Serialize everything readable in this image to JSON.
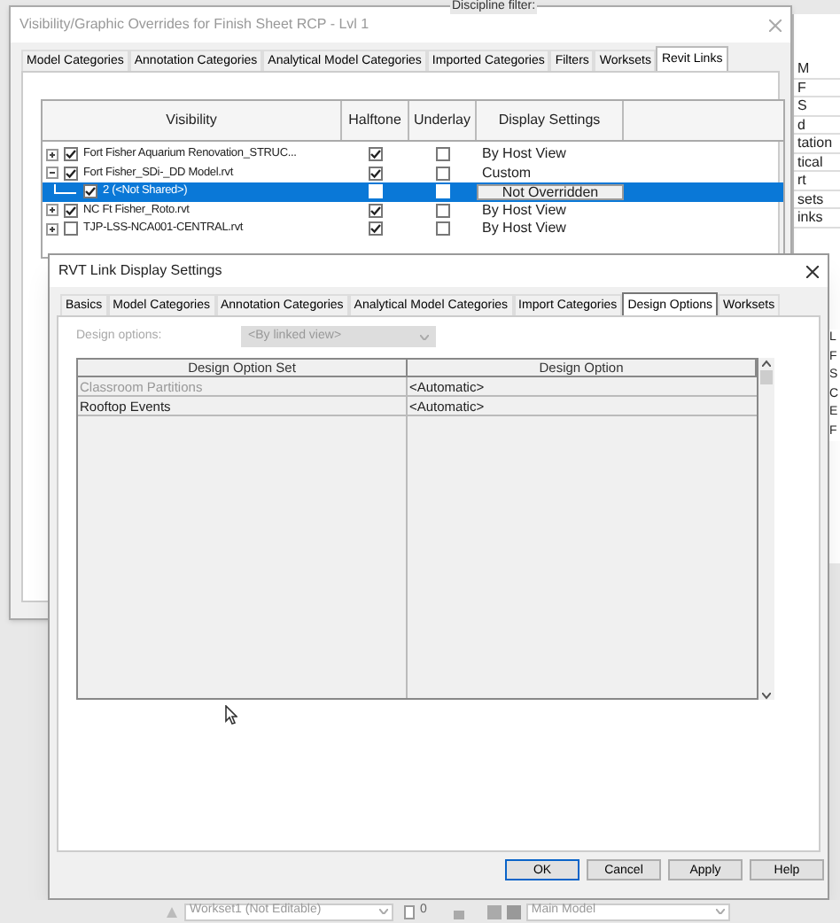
{
  "background": {
    "filter_label": "Discipline filter:",
    "side_column": [
      "M",
      "F",
      "S",
      "d",
      "tation",
      "tical",
      "rt",
      "sets",
      "inks"
    ],
    "side_column_lower": [
      "L",
      "F",
      "S",
      "C",
      "E",
      "F"
    ]
  },
  "outer_dialog": {
    "title": "Visibility/Graphic Overrides for Finish Sheet RCP - Lvl 1",
    "tabs": [
      {
        "label": "Model Categories",
        "selected": false
      },
      {
        "label": "Annotation Categories",
        "selected": false
      },
      {
        "label": "Analytical Model Categories",
        "selected": false
      },
      {
        "label": "Imported Categories",
        "selected": false
      },
      {
        "label": "Filters",
        "selected": false
      },
      {
        "label": "Worksets",
        "selected": false
      },
      {
        "label": "Revit Links",
        "selected": true
      }
    ],
    "columns": [
      "Visibility",
      "Halftone",
      "Underlay",
      "Display Settings"
    ],
    "rows": [
      {
        "name": "Fort Fisher Aquarium Renovation_STRUC...",
        "visible": true,
        "halftone": true,
        "underlay": false,
        "display": "By Host View",
        "expanded": false,
        "selected": false
      },
      {
        "name": "Fort Fisher_SDi-_DD Model.rvt",
        "visible": true,
        "halftone": true,
        "underlay": false,
        "display": "Custom",
        "expanded": true,
        "selected": false,
        "children": [
          {
            "name": "2 (<Not Shared>)",
            "visible": true,
            "halftone": false,
            "underlay": false,
            "display": "Not Overridden",
            "selected": true
          }
        ]
      },
      {
        "name": "NC Ft Fisher_Roto.rvt",
        "visible": true,
        "halftone": true,
        "underlay": false,
        "display": "By Host View",
        "expanded": false,
        "selected": false
      },
      {
        "name": "TJP-LSS-NCA001-CENTRAL.rvt",
        "visible": false,
        "halftone": true,
        "underlay": false,
        "display": "By Host View",
        "expanded": false,
        "selected": false
      }
    ]
  },
  "inner_dialog": {
    "title": "RVT Link Display Settings",
    "tabs": [
      {
        "label": "Basics",
        "selected": false
      },
      {
        "label": "Model Categories",
        "selected": false
      },
      {
        "label": "Annotation Categories",
        "selected": false
      },
      {
        "label": "Analytical Model Categories",
        "selected": false
      },
      {
        "label": "Import Categories",
        "selected": false
      },
      {
        "label": "Design Options",
        "selected": true
      },
      {
        "label": "Worksets",
        "selected": false
      }
    ],
    "design_options": {
      "label": "Design options:",
      "value": "<By linked view>",
      "disabled": true
    },
    "columns": [
      "Design Option Set",
      "Design Option"
    ],
    "rows": [
      {
        "set": "Classroom Partitions",
        "option": "<Automatic>",
        "disabled": true
      },
      {
        "set": "Rooftop Events",
        "option": "<Automatic>",
        "disabled": false
      }
    ],
    "buttons": [
      {
        "label": "OK",
        "default": true
      },
      {
        "label": "Cancel",
        "default": false
      },
      {
        "label": "Apply",
        "default": false
      },
      {
        "label": "Help",
        "default": false
      }
    ]
  },
  "status_bar": {
    "workset": "Workset1 (Not Editable)",
    "count": "0",
    "model": "Main Model"
  }
}
